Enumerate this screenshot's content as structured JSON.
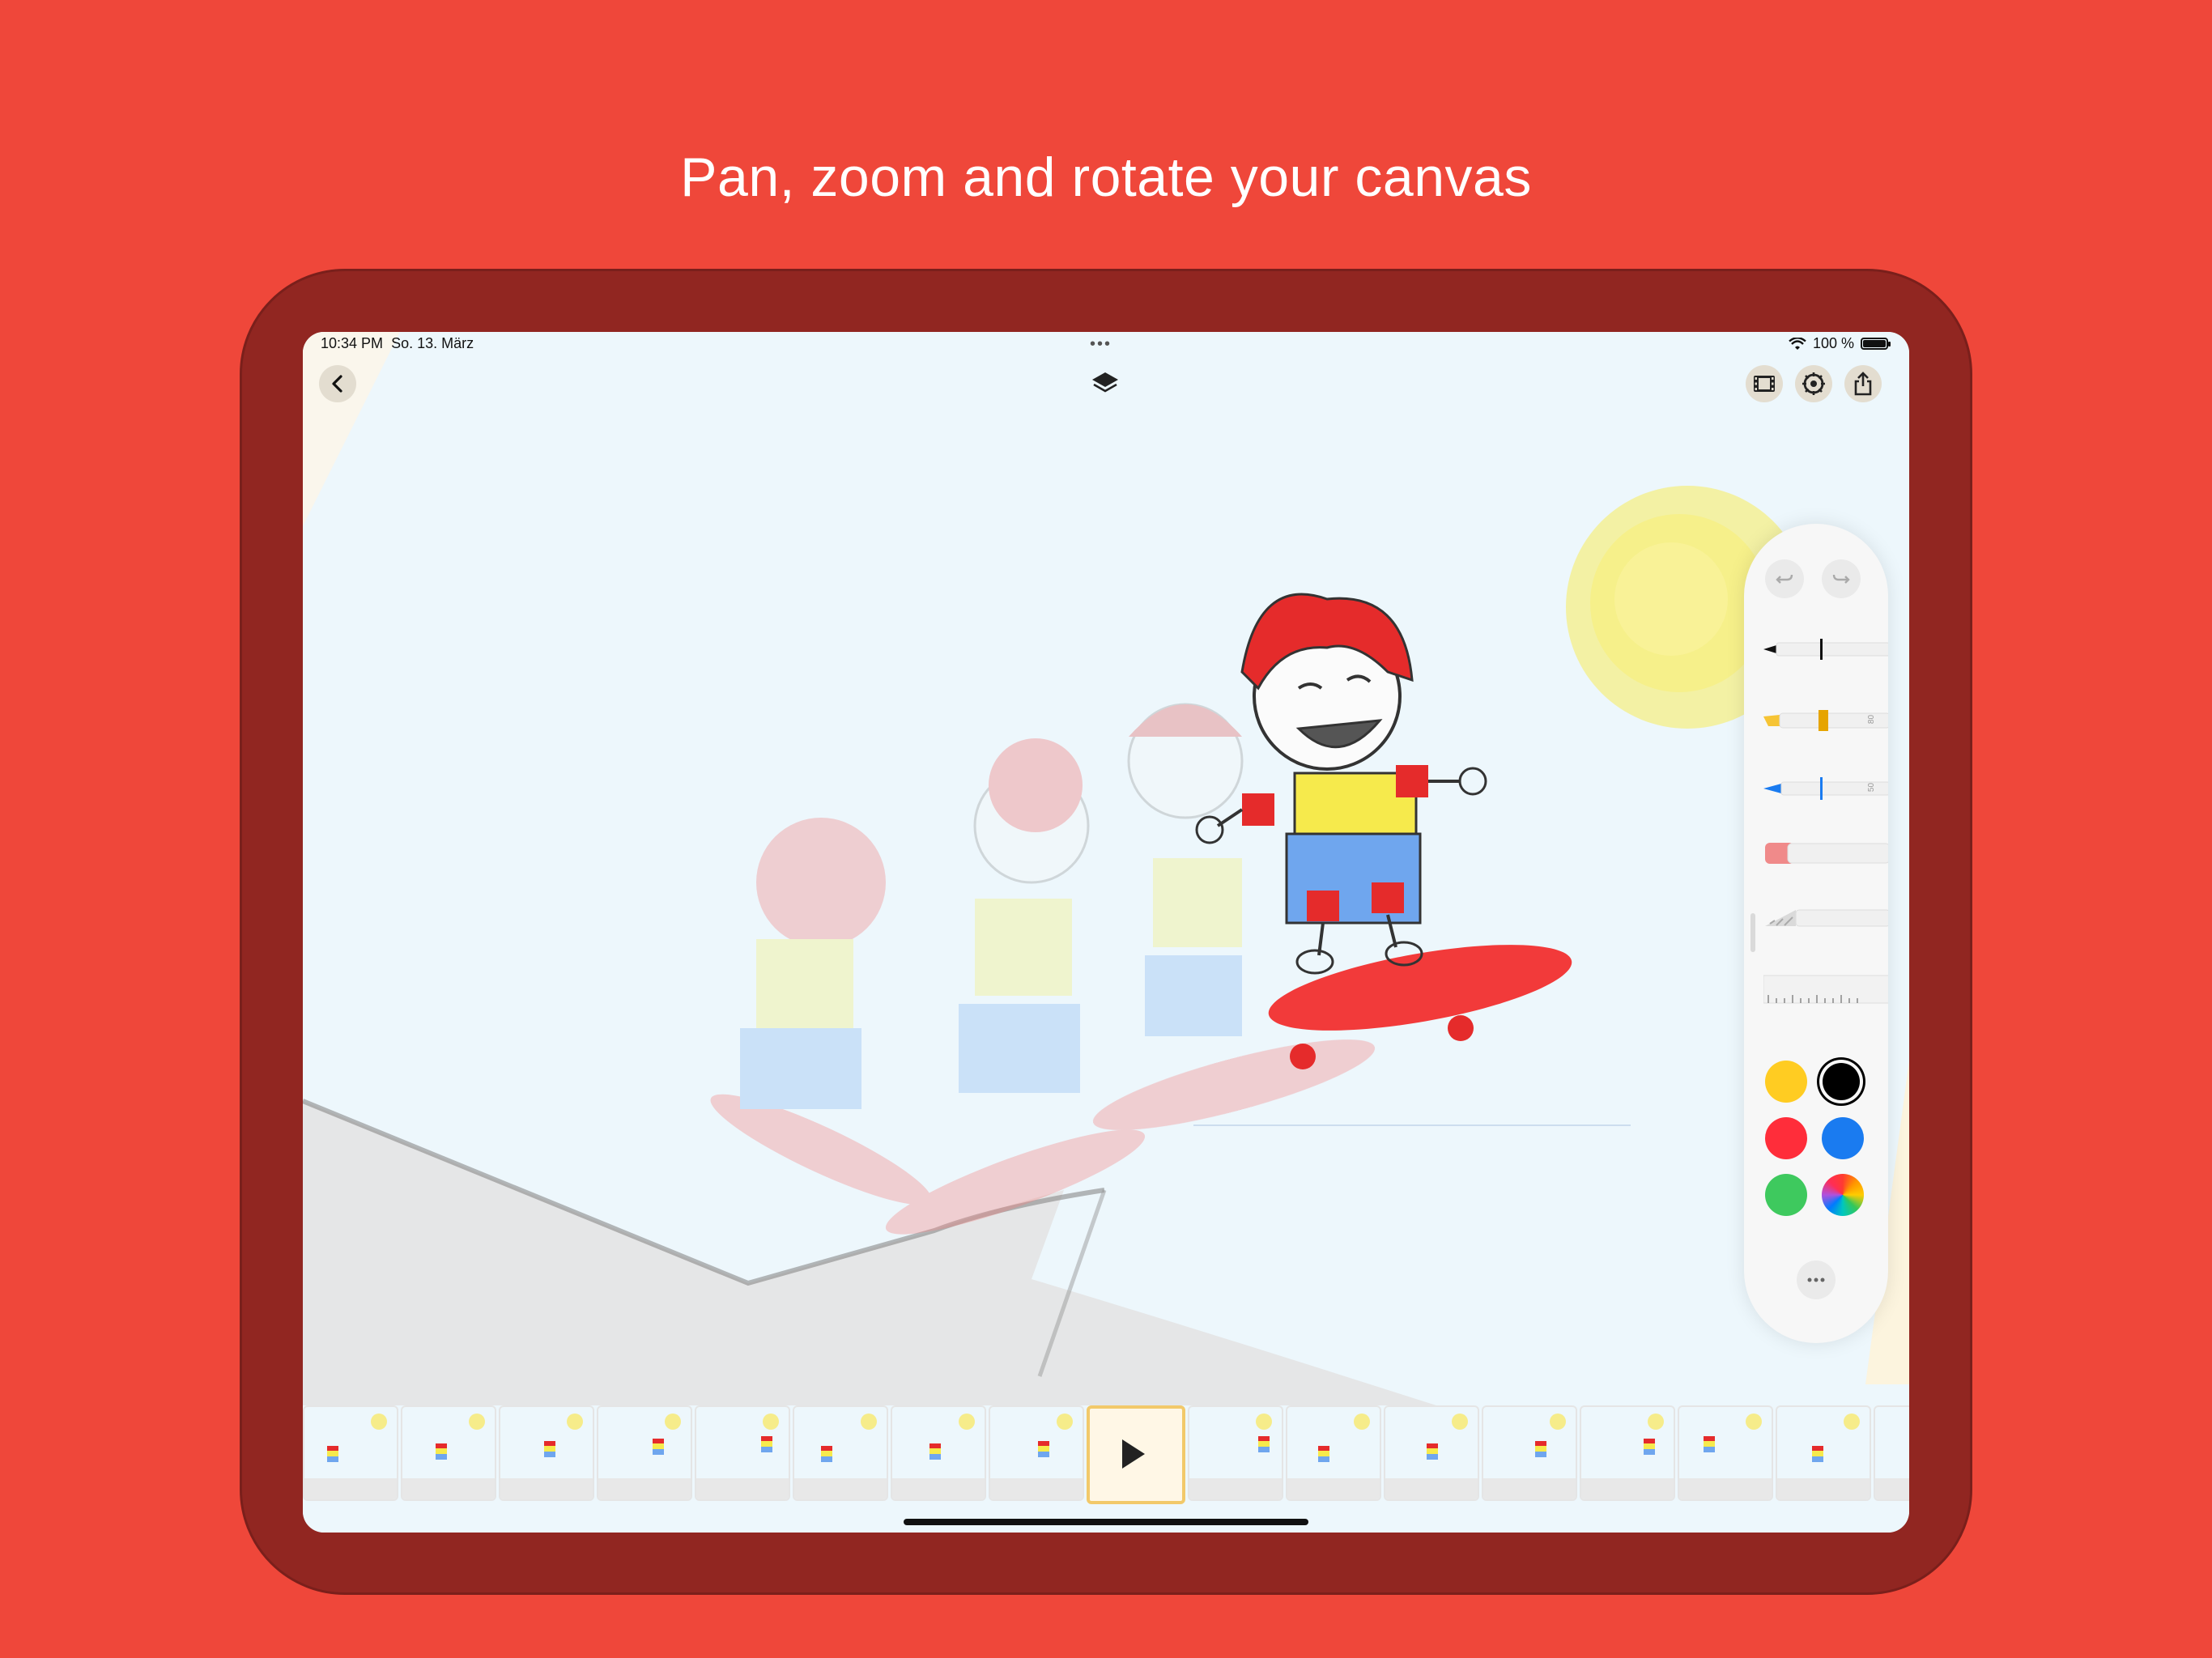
{
  "headline": "Pan, zoom and rotate your canvas",
  "status": {
    "time": "10:34 PM",
    "date": "So. 13. März",
    "battery": "100 %",
    "dots": "•••"
  },
  "toolbar": {
    "left": [
      "back-button"
    ],
    "center": [
      "layers-button"
    ],
    "right": [
      "filmstrip-button",
      "settings-button",
      "share-button"
    ]
  },
  "palette": {
    "highlighter_size": "80",
    "pen_size": "50",
    "colors": [
      {
        "name": "yellow",
        "hex": "#FFCC22"
      },
      {
        "name": "black",
        "hex": "#000000",
        "selected": true
      },
      {
        "name": "red",
        "hex": "#FF2D3A"
      },
      {
        "name": "blue",
        "hex": "#1A7BF0"
      },
      {
        "name": "green",
        "hex": "#3EC95E"
      },
      {
        "name": "multicolor",
        "hex": "conic"
      }
    ]
  },
  "filmstrip": {
    "frame_count": 17,
    "selected_index": 8
  }
}
